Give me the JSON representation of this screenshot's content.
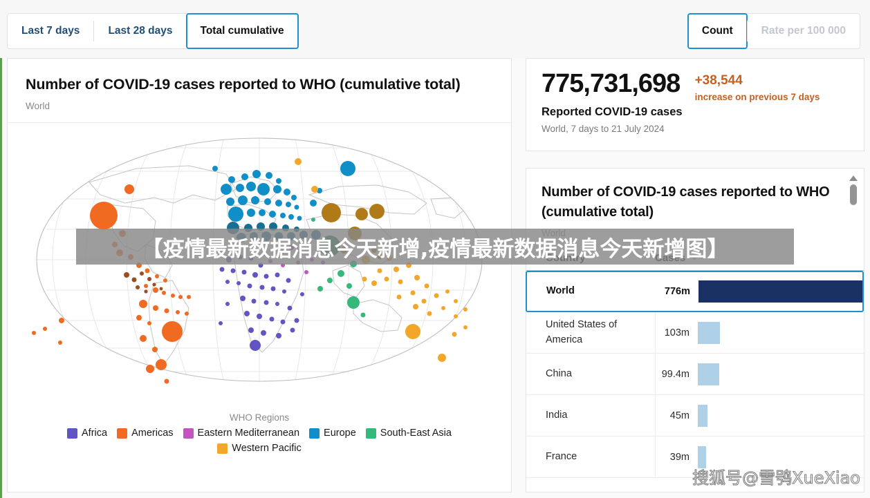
{
  "toolbar": {
    "period_tabs": [
      {
        "label": "Last 7 days",
        "active": false
      },
      {
        "label": "Last 28 days",
        "active": false
      },
      {
        "label": "Total cumulative",
        "active": true
      }
    ],
    "measure_tabs": [
      {
        "label": "Count",
        "active": true
      },
      {
        "label": "Rate per 100 000",
        "active": false
      }
    ]
  },
  "map_card": {
    "title": "Number of COVID-19 cases reported to WHO (cumulative total)",
    "subtitle": "World",
    "legend_title": "WHO Regions",
    "legend": [
      {
        "label": "Africa",
        "color": "#6155c4"
      },
      {
        "label": "Americas",
        "color": "#f06a22"
      },
      {
        "label": "Eastern Mediterranean",
        "color": "#c455c0"
      },
      {
        "label": "Europe",
        "color": "#108ec8"
      },
      {
        "label": "South-East Asia",
        "color": "#35b87a"
      },
      {
        "label": "Western Pacific",
        "color": "#f3a72a"
      }
    ]
  },
  "stat_card": {
    "value": "775,731,698",
    "label": "Reported COVID-19 cases",
    "scope": "World, 7 days to 21 July 2024",
    "delta": "+38,544",
    "delta_note": "increase on previous 7 days",
    "delta_color": "#c5601f"
  },
  "table_card": {
    "title": "Number of COVID-19 cases reported to WHO (cumulative total)",
    "subtitle": "World",
    "columns": {
      "country": "Country",
      "cases": "Cases"
    },
    "sort": "descending",
    "bar_color_selected": "#1a3263",
    "bar_color_default": "#aed1e8",
    "rows": [
      {
        "country": "World",
        "cases": "776m",
        "bar_pct": 100,
        "selected": true
      },
      {
        "country": "United States of America",
        "cases": "103m",
        "bar_pct": 13.3,
        "selected": false
      },
      {
        "country": "China",
        "cases": "99.4m",
        "bar_pct": 12.8,
        "selected": false
      },
      {
        "country": "India",
        "cases": "45m",
        "bar_pct": 5.8,
        "selected": false
      },
      {
        "country": "France",
        "cases": "39m",
        "bar_pct": 5.0,
        "selected": false
      }
    ]
  },
  "watermarks": {
    "band_text": "【疫情最新数据消息今天新增,疫情最新数据消息今天新增图】",
    "corner_text": "搜狐号@雪鸮XueXiao"
  },
  "chart_data": {
    "type": "bar",
    "title": "Number of COVID-19 cases reported to WHO (cumulative total)",
    "subtitle": "World",
    "xlabel": "Cases",
    "ylabel": "Country",
    "categories": [
      "World",
      "United States of America",
      "China",
      "India",
      "France"
    ],
    "values": [
      776000000,
      103000000,
      99400000,
      45000000,
      39000000
    ],
    "value_labels": [
      "776m",
      "103m",
      "99.4m",
      "45m",
      "39m"
    ],
    "map": {
      "type": "bubble-map",
      "projection": "robinson",
      "legend_title": "WHO Regions",
      "regions": [
        "Africa",
        "Americas",
        "Eastern Mediterranean",
        "Europe",
        "South-East Asia",
        "Western Pacific"
      ],
      "region_colors": [
        "#6155c4",
        "#f06a22",
        "#c455c0",
        "#108ec8",
        "#35b87a",
        "#f3a72a"
      ]
    }
  }
}
